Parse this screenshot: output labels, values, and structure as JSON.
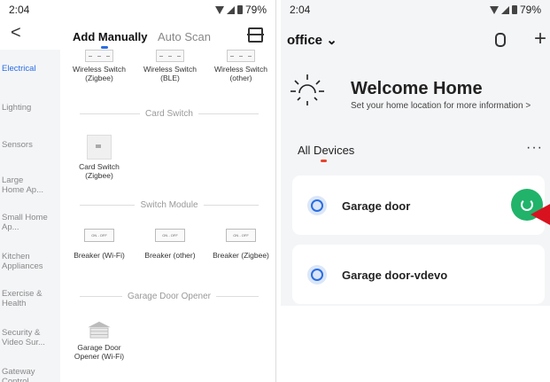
{
  "left": {
    "status": {
      "time": "2:04",
      "battery": "79%"
    },
    "tabs": {
      "active": "Add Manually",
      "inactive": "Auto Scan"
    },
    "sidebar": [
      {
        "label": "Electrical",
        "active": true
      },
      {
        "label": "Lighting"
      },
      {
        "label": "Sensors"
      },
      {
        "label": "Large Home Ap..."
      },
      {
        "label": "Small Home Ap..."
      },
      {
        "label": "Kitchen Appliances"
      },
      {
        "label": "Exercise & Health"
      },
      {
        "label": "Security & Video Sur..."
      },
      {
        "label": "Gateway Control"
      }
    ],
    "wireless": [
      "Wireless Switch (Zigbee)",
      "Wireless Switch (BLE)",
      "Wireless Switch (other)"
    ],
    "card_section": "Card Switch",
    "card_item": "Card Switch (Zigbee)",
    "module_section": "Switch Module",
    "breakers": [
      "Breaker (Wi-Fi)",
      "Breaker (other)",
      "Breaker (Zigbee)"
    ],
    "breaker_label": "ON - OFF",
    "garage_section": "Garage Door Opener",
    "garage_item": "Garage Door Opener (Wi-Fi)"
  },
  "right": {
    "status": {
      "time": "2:04",
      "battery": "79%"
    },
    "home": "office",
    "chevron": "⌄",
    "welcome": "Welcome Home",
    "subtitle": "Set your home location for more information >",
    "tab": "All Devices",
    "more": "···",
    "devices": [
      "Garage door",
      "Garage door-vdevo"
    ]
  }
}
